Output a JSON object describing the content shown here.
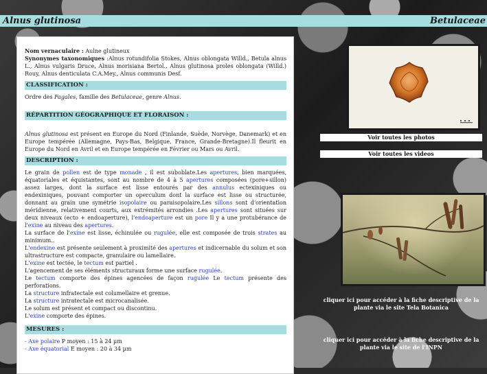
{
  "header": {
    "title": "Alnus glutinosa",
    "family": "Betulaceae"
  },
  "info": {
    "vernacular_label": "Nom vernaculaire :",
    "vernacular_value": " Aulne glutineux",
    "synonyms_label": "Synonymes taxonomiques",
    "synonyms_value": " :Alnus rotundifolia Stokes, Alnus oblongata Willd., Betula alnus L., Alnus vulgaris Druce, Alnus morisiana Bertol., Alnus glutinosa proles oblongata (Willd.) Rouy, Alnus denticulata C.A.Mey., Alnus communis Desf."
  },
  "classification": {
    "heading": "CLASSIFICATION :",
    "t1": "Ordre des ",
    "order": "Fagales",
    "t2": ", famille des ",
    "family": "Betulaceae",
    "t3": ", genre ",
    "genus": "Alnus",
    "t4": "."
  },
  "repartition": {
    "heading": "RÉPARTITION GÉOGRAPHIQUE ET FLORAISON :",
    "species": "Alnus glutinosa",
    "text": " est présent en Europe du Nord (Finlande, Suède, Norvège, Danemark) et en Europe tempérée (Allemagne, Pays-Bas, Belgique, France, Grande-Bretagne).Il fleurit en Europe du Nord en Avril et en Europe tempérée en Février ou Mars ou Avril."
  },
  "description": {
    "heading": "DESCRIPTION :",
    "p1": [
      {
        "t": "Le grain de "
      },
      {
        "t": "pollen",
        "link": true
      },
      {
        "t": " est de type "
      },
      {
        "t": "monade",
        "link": true
      },
      {
        "t": " , il est suboblate.Les "
      },
      {
        "t": "apertures",
        "link": true
      },
      {
        "t": ", bien marquées, équatoriales et équistantes, sont au nombre de 4 à 5 "
      },
      {
        "t": "apertures",
        "link": true
      },
      {
        "t": " composées (pore+sillon) assez larges, dont la surface est lisse entourés par des "
      },
      {
        "t": "annulus",
        "link": true
      },
      {
        "t": " ectexiniques ou endexiniques, pouvant comporter un operculum dont la surface est lisse ou structurée, donnant au grain une symétrie "
      },
      {
        "t": "isopolaire",
        "link": true
      },
      {
        "t": " ou paraisopolaire.Les "
      },
      {
        "t": "sillons",
        "link": true
      },
      {
        "t": " sont d'orientation méridienne, relativement courts, aux extrémités arrondies .Les "
      },
      {
        "t": "apertures",
        "link": true
      },
      {
        "t": " sont situées sur deux niveaux (ecto + endoaperture), l'"
      },
      {
        "t": "endoaperture",
        "link": true
      },
      {
        "t": " est un "
      },
      {
        "t": "pore",
        "link": true
      },
      {
        "t": " Il y a une protubérance de l'"
      },
      {
        "t": "exine",
        "link": true
      },
      {
        "t": " au niveau des "
      },
      {
        "t": "apertures",
        "link": true
      },
      {
        "t": "."
      }
    ],
    "lines": [
      [
        {
          "t": "La surface de l'"
        },
        {
          "t": "exine",
          "link": true
        },
        {
          "t": " est lisse, échinulée ou "
        },
        {
          "t": "rugulée",
          "link": true
        },
        {
          "t": ", elle est composée de trois "
        },
        {
          "t": "strates",
          "link": true
        },
        {
          "t": " au minimum.."
        }
      ],
      [
        {
          "t": "L'"
        },
        {
          "t": "endexine",
          "link": true
        },
        {
          "t": " est présente seulement à proximité des "
        },
        {
          "t": "apertures",
          "link": true
        },
        {
          "t": " et indicernable du solum et son ultrastructure est compacte, granulaire ou lamellaire."
        }
      ],
      [
        {
          "t": "L'"
        },
        {
          "t": "exine",
          "link": true
        },
        {
          "t": " est tectée, le "
        },
        {
          "t": "tectum",
          "link": true
        },
        {
          "t": " est partiel ."
        }
      ],
      [
        {
          "t": "L'agencement de ses éléments structuraux forme une surface "
        },
        {
          "t": "rugulée",
          "link": true
        },
        {
          "t": "."
        }
      ],
      [
        {
          "t": "Le "
        },
        {
          "t": "tectum",
          "link": true
        },
        {
          "t": " comporte des épines agencées de façon "
        },
        {
          "t": "rugulée",
          "link": true
        },
        {
          "t": " Le "
        },
        {
          "t": "tectum",
          "link": true
        },
        {
          "t": " présente des perforations."
        }
      ],
      [
        {
          "t": "La "
        },
        {
          "t": "structure",
          "link": true
        },
        {
          "t": " infratectale est columellaire et grenue."
        }
      ],
      [
        {
          "t": "La "
        },
        {
          "t": "structure",
          "link": true
        },
        {
          "t": " intratectale est microcanalisée."
        }
      ],
      [
        {
          "t": "Le solum est présent et compact ou discontinu."
        }
      ],
      [
        {
          "t": "L'"
        },
        {
          "t": "exine",
          "link": true
        },
        {
          "t": " comporte des épines."
        }
      ]
    ]
  },
  "mesures": {
    "heading": "MESURES :",
    "rows": [
      {
        "dash": "- ",
        "link": "Axe polaire",
        "text": " P moyen : 15 à 24 µm"
      },
      {
        "dash": "- ",
        "link": "Axe équatorial",
        "text": " E moyen : 20 à 34 µm"
      }
    ]
  },
  "sidebar": {
    "photos_btn": "Voir toutes les photos",
    "videos_btn": "Voir toutes les videos",
    "tela_link": "cliquer ici pour accéder à la fiche descriptive de la plante via le site Tela Botanica",
    "inpn_link": "cliquer ici pour accéder à la fiche descriptive de la plante via le site de l'INPN"
  },
  "colors": {
    "accent": "#a7dde0",
    "link": "#2a40c0",
    "pollen": "#c8621e"
  },
  "icons": [
    "pollen-grain-image",
    "alder-catkins-photo"
  ]
}
